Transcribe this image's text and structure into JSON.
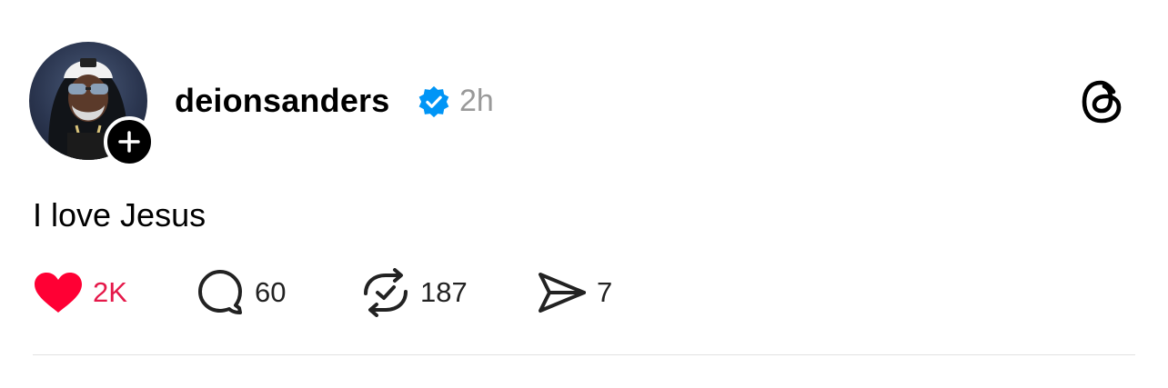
{
  "post": {
    "username": "deionsanders",
    "timestamp": "2h",
    "text": "I love Jesus",
    "verified": true
  },
  "actions": {
    "likes": "2K",
    "comments": "60",
    "reposts": "187",
    "shares": "7"
  },
  "colors": {
    "like_red": "#e5194a",
    "verified_blue": "#0095f6",
    "timestamp_gray": "#999999"
  },
  "icons": {
    "avatar": "profile-photo",
    "follow": "plus-icon",
    "verified": "verified-badge-icon",
    "app": "threads-logo-icon",
    "like": "heart-icon",
    "comment": "comment-bubble-icon",
    "repost": "repost-icon",
    "share": "send-icon"
  }
}
